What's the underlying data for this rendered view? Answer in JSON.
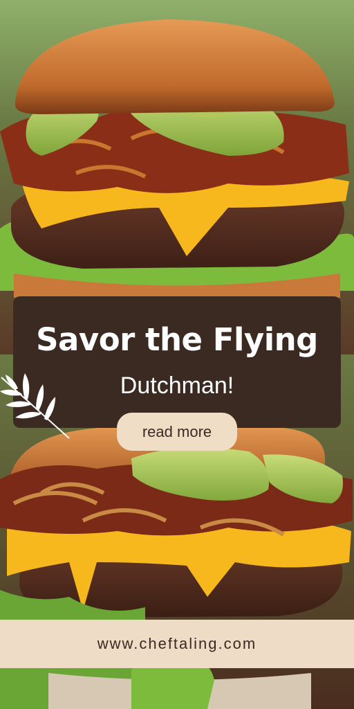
{
  "headline": "Savor the Flying",
  "subheadline": "Dutchman!",
  "cta_label": "read more",
  "website": "www.cheftaling.com",
  "colors": {
    "card_background": "#3a2a22",
    "button_background": "#f0ddc6",
    "banner_background": "#efdcc6",
    "text_light": "#ffffff",
    "text_dark": "#3a2a22"
  },
  "icons": {
    "decoration": "leaf-sprig-icon"
  }
}
